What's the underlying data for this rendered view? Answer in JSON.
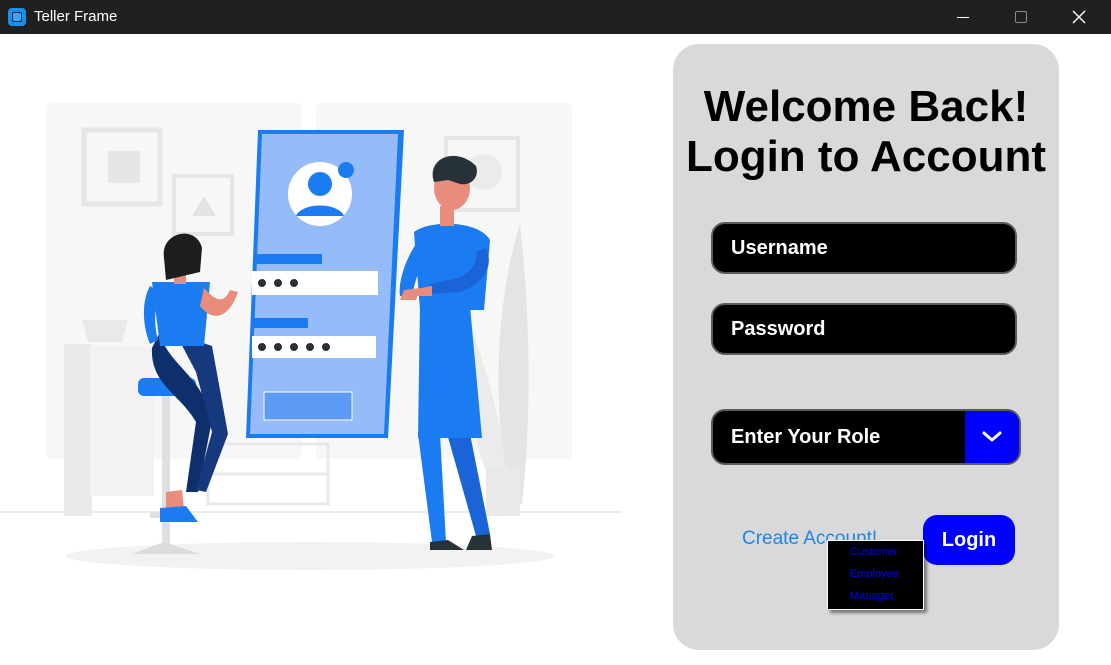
{
  "window": {
    "title": "Teller Frame",
    "controls": {
      "minimize": "minimize-icon",
      "maximize": "maximize-icon",
      "close": "close-icon"
    }
  },
  "illustration": {
    "icon": "login-illustration"
  },
  "login": {
    "heading_line1": "Welcome Back!",
    "heading_line2": "Login to Account",
    "username_placeholder": "Username",
    "password_placeholder": "Password",
    "role_label": "Enter Your Role",
    "role_options": [
      "Customer",
      "Employee",
      "Manager"
    ],
    "create_account": "Create Account!",
    "login_button": "Login"
  },
  "colors": {
    "title_bar": "#202020",
    "panel": "#d9d9d9",
    "field": "#000000",
    "accent": "#0000ff",
    "link": "#1b86e6"
  }
}
